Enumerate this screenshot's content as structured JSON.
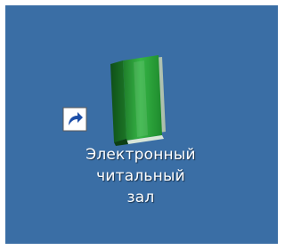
{
  "desktop": {
    "background_color": "#3a6ea5",
    "icons": [
      {
        "icon_name": "green-book-icon",
        "overlay_icon_name": "shortcut-arrow-icon",
        "label_lines": [
          "Электронный",
          "читальный",
          "зал"
        ],
        "accent_color": "#2e9e3a"
      }
    ]
  }
}
